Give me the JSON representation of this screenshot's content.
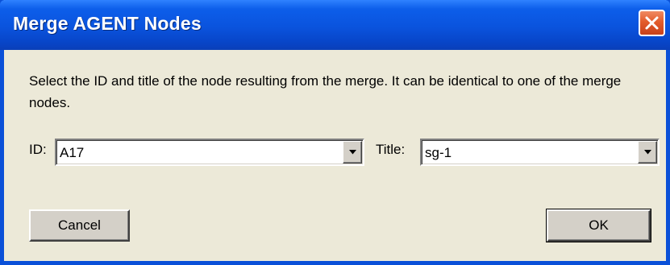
{
  "window": {
    "title": "Merge AGENT Nodes",
    "close_icon": "close-icon"
  },
  "message": "Select the ID and title of the node resulting from the merge. It can be identical to one of the merge nodes.",
  "id_field": {
    "label": "ID:",
    "value": "A17"
  },
  "title_field": {
    "label": "Title:",
    "value": "sg-1"
  },
  "buttons": {
    "cancel": "Cancel",
    "ok": "OK"
  },
  "colors": {
    "titlebar": "#0A53DD",
    "close_button": "#E35C2C",
    "dialog_background": "#ECE9D8",
    "button_face": "#D4D0C8"
  }
}
